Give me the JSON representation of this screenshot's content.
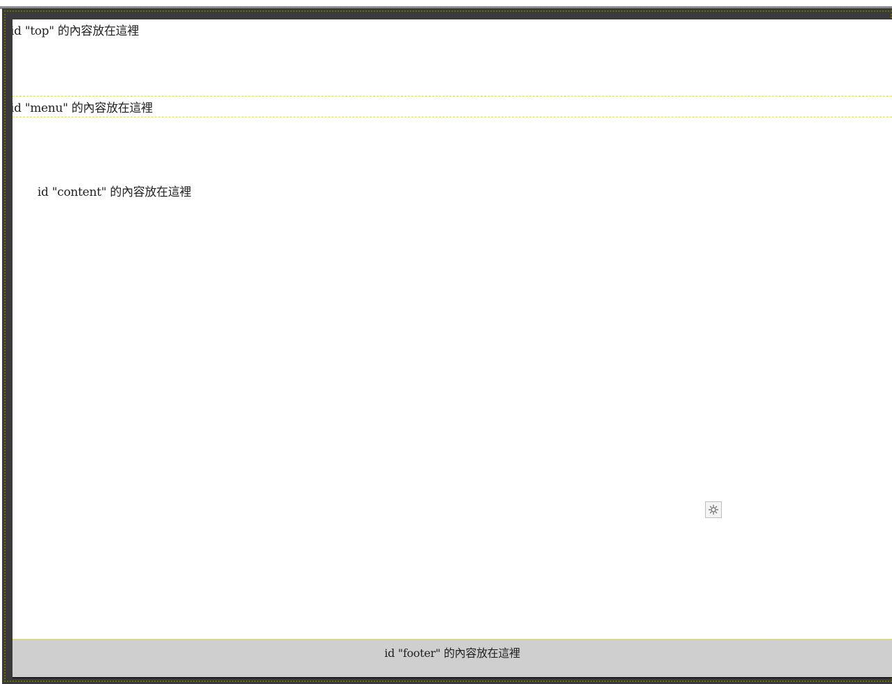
{
  "layout": {
    "top": {
      "label": "id \"top\" 的內容放在這裡"
    },
    "menu": {
      "label": "id \"menu\" 的內容放在這裡"
    },
    "content": {
      "label": "id \"content\" 的內容放在這裡"
    },
    "footer": {
      "label": "id \"footer\" 的內容放在這裡"
    }
  },
  "icons": {
    "gear": "gear-icon"
  },
  "colors": {
    "frame": "#3a3a3a",
    "guide_dash": "#e8e800",
    "footer_bg": "#cfcfcf",
    "page_bg": "#ffffff"
  }
}
